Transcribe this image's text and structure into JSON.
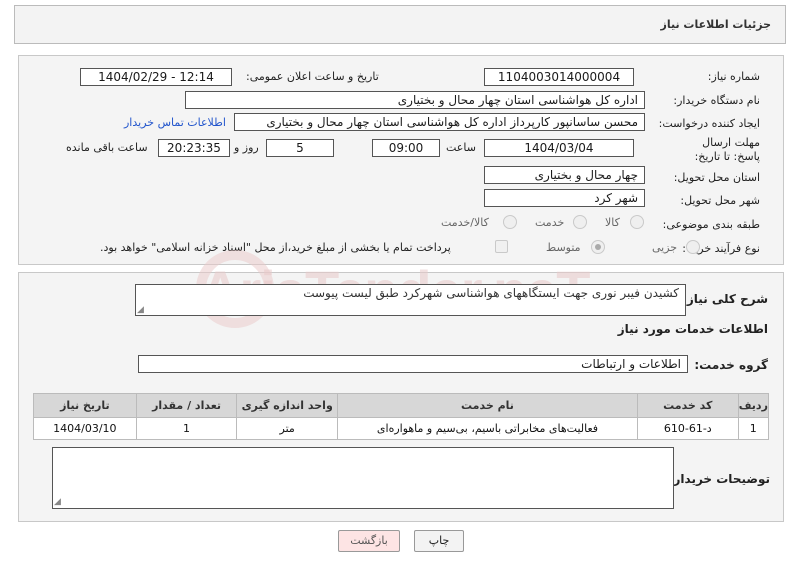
{
  "header": {
    "title": "جزئیات اطلاعات نیاز"
  },
  "form": {
    "need_number_label": "شماره نیاز:",
    "need_number": "1104003014000004",
    "announce_label": "تاریخ و ساعت اعلان عمومی:",
    "announce_value": "1404/02/29 - 12:14",
    "buyer_org_label": "نام دستگاه خریدار:",
    "buyer_org": "اداره کل هواشناسی استان چهار محال و بختیاری",
    "creator_label": "ایجاد کننده درخواست:",
    "creator": "محسن ساسانپور کارپرداز اداره کل هواشناسی استان چهار محال و بختیاری",
    "contact_link": "اطلاعات تماس خریدار",
    "deadline_label": "مهلت ارسال پاسخ: تا تاریخ:",
    "deadline_date": "1404/03/04",
    "time_label": "ساعت",
    "deadline_time": "09:00",
    "days_value": "5",
    "days_label": "روز و",
    "remaining_time": "20:23:35",
    "remaining_label": "ساعت باقی مانده",
    "province_label": "استان محل تحویل:",
    "province": "چهار محال و بختیاری",
    "city_label": "شهر محل تحویل:",
    "city": "شهر کرد",
    "category_label": "طبقه بندی موضوعی:",
    "category_options": [
      "کالا",
      "خدمت",
      "کالا/خدمت"
    ],
    "process_label": "نوع فرآیند خرید :",
    "process_options": [
      "جزیی",
      "متوسط"
    ],
    "payment_note": "پرداخت تمام یا بخشی از مبلغ خرید،از محل \"اسناد خزانه اسلامی\" خواهد بود."
  },
  "summary": {
    "label": "شرح کلی نیاز:",
    "text": "کشیدن فیبر نوری جهت ایستگاههای هواشناسی شهرکرد طبق لیست پیوست"
  },
  "services": {
    "section_title": "اطلاعات خدمات مورد نیاز",
    "group_label": "گروه خدمت:",
    "group_value": "اطلاعات و ارتباطات",
    "columns": [
      "ردیف",
      "کد خدمت",
      "نام خدمت",
      "واحد اندازه گیری",
      "تعداد / مقدار",
      "تاریخ نیاز"
    ],
    "rows": [
      [
        "1",
        "د-61-610",
        "فعالیت‌های مخابراتی باسیم، بی‌سیم و ماهواره‌ای",
        "متر",
        "1",
        "1404/03/10"
      ]
    ]
  },
  "buyer_notes": {
    "label": "توضیحات خریدار:",
    "value": ""
  },
  "buttons": {
    "print": "چاپ",
    "back": "بازگشت"
  },
  "watermark": {
    "text": "AriaTender.neT"
  }
}
